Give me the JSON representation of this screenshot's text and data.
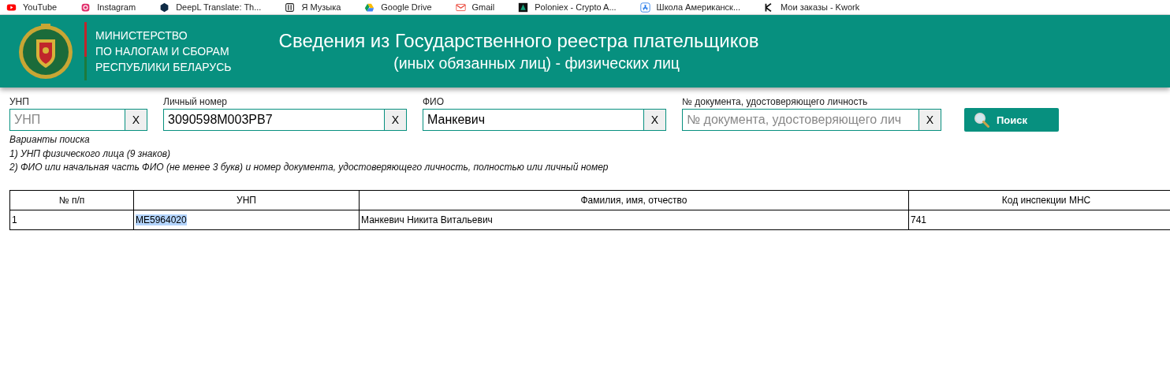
{
  "bookmarks": [
    {
      "label": "YouTube",
      "kind": "youtube"
    },
    {
      "label": "Instagram",
      "kind": "instagram"
    },
    {
      "label": "DeepL Translate: Th...",
      "kind": "deepl"
    },
    {
      "label": "Я Музыка",
      "kind": "music"
    },
    {
      "label": "Google Drive",
      "kind": "drive"
    },
    {
      "label": "Gmail",
      "kind": "gmail"
    },
    {
      "label": "Poloniex - Crypto A...",
      "kind": "poloniex"
    },
    {
      "label": "Школа Американск...",
      "kind": "appstore"
    },
    {
      "label": "Мои заказы - Kwork",
      "kind": "kwork"
    }
  ],
  "header": {
    "org_lines": [
      "МИНИСТЕРСТВО",
      "ПО НАЛОГАМ И СБОРАМ",
      "РЕСПУБЛИКИ БЕЛАРУСЬ"
    ],
    "title": "Сведения из Государственного реестра плательщиков",
    "subtitle": "(иных обязанных лиц) - физических лиц"
  },
  "fields": [
    {
      "label": "УНП",
      "placeholder": "УНП",
      "clear": "X"
    },
    {
      "label": "Личный номер",
      "value": "3090598M003PB7",
      "clear": "X"
    },
    {
      "label": "ФИО",
      "value": "Манкевич",
      "clear": "X"
    },
    {
      "label": "№ документа, удостоверяющего личность",
      "placeholder": "№ документа, удостоверяющего лич",
      "clear": "X"
    }
  ],
  "search_button": "Поиск",
  "hints": [
    "Варианты поиска",
    "1) УНП физического лица (9 знаков)",
    "2) ФИО или начальная часть ФИО (не менее 3 букв) и номер документа, удостоверяющего личность, полностью или личный номер"
  ],
  "table": {
    "columns": [
      "№ п/п",
      "УНП",
      "Фамилия, имя, отчество",
      "Код инспекции МНС"
    ],
    "rows": [
      [
        {
          "text": "1",
          "highlighted": false
        },
        {
          "text": "МЕ5964020",
          "highlighted": true
        },
        {
          "text": "Манкевич Никита Витальевич",
          "highlighted": false
        },
        {
          "text": "741",
          "highlighted": false
        }
      ]
    ]
  }
}
